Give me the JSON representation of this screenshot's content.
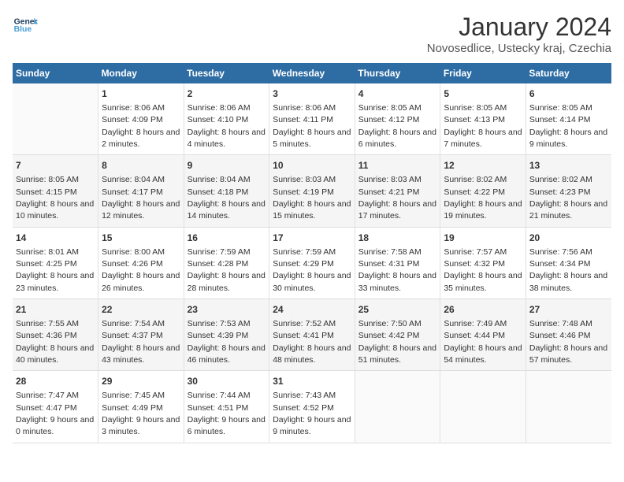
{
  "header": {
    "logo_line1": "General",
    "logo_line2": "Blue",
    "month": "January 2024",
    "location": "Novosedlice, Ustecky kraj, Czechia"
  },
  "weekdays": [
    "Sunday",
    "Monday",
    "Tuesday",
    "Wednesday",
    "Thursday",
    "Friday",
    "Saturday"
  ],
  "weeks": [
    [
      {
        "day": "",
        "sunrise": "",
        "sunset": "",
        "daylight": ""
      },
      {
        "day": "1",
        "sunrise": "8:06 AM",
        "sunset": "4:09 PM",
        "daylight": "8 hours and 2 minutes."
      },
      {
        "day": "2",
        "sunrise": "8:06 AM",
        "sunset": "4:10 PM",
        "daylight": "8 hours and 4 minutes."
      },
      {
        "day": "3",
        "sunrise": "8:06 AM",
        "sunset": "4:11 PM",
        "daylight": "8 hours and 5 minutes."
      },
      {
        "day": "4",
        "sunrise": "8:05 AM",
        "sunset": "4:12 PM",
        "daylight": "8 hours and 6 minutes."
      },
      {
        "day": "5",
        "sunrise": "8:05 AM",
        "sunset": "4:13 PM",
        "daylight": "8 hours and 7 minutes."
      },
      {
        "day": "6",
        "sunrise": "8:05 AM",
        "sunset": "4:14 PM",
        "daylight": "8 hours and 9 minutes."
      }
    ],
    [
      {
        "day": "7",
        "sunrise": "8:05 AM",
        "sunset": "4:15 PM",
        "daylight": "8 hours and 10 minutes."
      },
      {
        "day": "8",
        "sunrise": "8:04 AM",
        "sunset": "4:17 PM",
        "daylight": "8 hours and 12 minutes."
      },
      {
        "day": "9",
        "sunrise": "8:04 AM",
        "sunset": "4:18 PM",
        "daylight": "8 hours and 14 minutes."
      },
      {
        "day": "10",
        "sunrise": "8:03 AM",
        "sunset": "4:19 PM",
        "daylight": "8 hours and 15 minutes."
      },
      {
        "day": "11",
        "sunrise": "8:03 AM",
        "sunset": "4:21 PM",
        "daylight": "8 hours and 17 minutes."
      },
      {
        "day": "12",
        "sunrise": "8:02 AM",
        "sunset": "4:22 PM",
        "daylight": "8 hours and 19 minutes."
      },
      {
        "day": "13",
        "sunrise": "8:02 AM",
        "sunset": "4:23 PM",
        "daylight": "8 hours and 21 minutes."
      }
    ],
    [
      {
        "day": "14",
        "sunrise": "8:01 AM",
        "sunset": "4:25 PM",
        "daylight": "8 hours and 23 minutes."
      },
      {
        "day": "15",
        "sunrise": "8:00 AM",
        "sunset": "4:26 PM",
        "daylight": "8 hours and 26 minutes."
      },
      {
        "day": "16",
        "sunrise": "7:59 AM",
        "sunset": "4:28 PM",
        "daylight": "8 hours and 28 minutes."
      },
      {
        "day": "17",
        "sunrise": "7:59 AM",
        "sunset": "4:29 PM",
        "daylight": "8 hours and 30 minutes."
      },
      {
        "day": "18",
        "sunrise": "7:58 AM",
        "sunset": "4:31 PM",
        "daylight": "8 hours and 33 minutes."
      },
      {
        "day": "19",
        "sunrise": "7:57 AM",
        "sunset": "4:32 PM",
        "daylight": "8 hours and 35 minutes."
      },
      {
        "day": "20",
        "sunrise": "7:56 AM",
        "sunset": "4:34 PM",
        "daylight": "8 hours and 38 minutes."
      }
    ],
    [
      {
        "day": "21",
        "sunrise": "7:55 AM",
        "sunset": "4:36 PM",
        "daylight": "8 hours and 40 minutes."
      },
      {
        "day": "22",
        "sunrise": "7:54 AM",
        "sunset": "4:37 PM",
        "daylight": "8 hours and 43 minutes."
      },
      {
        "day": "23",
        "sunrise": "7:53 AM",
        "sunset": "4:39 PM",
        "daylight": "8 hours and 46 minutes."
      },
      {
        "day": "24",
        "sunrise": "7:52 AM",
        "sunset": "4:41 PM",
        "daylight": "8 hours and 48 minutes."
      },
      {
        "day": "25",
        "sunrise": "7:50 AM",
        "sunset": "4:42 PM",
        "daylight": "8 hours and 51 minutes."
      },
      {
        "day": "26",
        "sunrise": "7:49 AM",
        "sunset": "4:44 PM",
        "daylight": "8 hours and 54 minutes."
      },
      {
        "day": "27",
        "sunrise": "7:48 AM",
        "sunset": "4:46 PM",
        "daylight": "8 hours and 57 minutes."
      }
    ],
    [
      {
        "day": "28",
        "sunrise": "7:47 AM",
        "sunset": "4:47 PM",
        "daylight": "9 hours and 0 minutes."
      },
      {
        "day": "29",
        "sunrise": "7:45 AM",
        "sunset": "4:49 PM",
        "daylight": "9 hours and 3 minutes."
      },
      {
        "day": "30",
        "sunrise": "7:44 AM",
        "sunset": "4:51 PM",
        "daylight": "9 hours and 6 minutes."
      },
      {
        "day": "31",
        "sunrise": "7:43 AM",
        "sunset": "4:52 PM",
        "daylight": "9 hours and 9 minutes."
      },
      {
        "day": "",
        "sunrise": "",
        "sunset": "",
        "daylight": ""
      },
      {
        "day": "",
        "sunrise": "",
        "sunset": "",
        "daylight": ""
      },
      {
        "day": "",
        "sunrise": "",
        "sunset": "",
        "daylight": ""
      }
    ]
  ],
  "labels": {
    "sunrise_prefix": "Sunrise: ",
    "sunset_prefix": "Sunset: ",
    "daylight_prefix": "Daylight: "
  }
}
